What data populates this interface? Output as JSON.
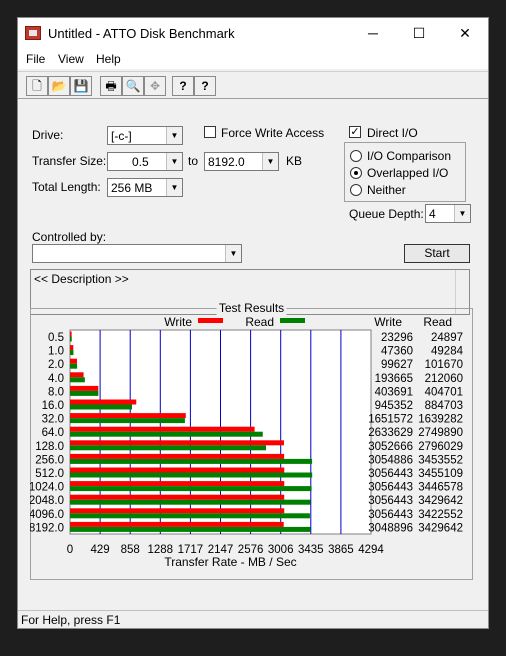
{
  "window": {
    "title": "Untitled - ATTO Disk Benchmark",
    "minimize": "─",
    "maximize": "☐",
    "close": "✕"
  },
  "menu": {
    "file": "File",
    "view": "View",
    "help": "Help"
  },
  "toolbar": {
    "new": "🗋",
    "open": "📂",
    "save": "💾",
    "print": "🖶",
    "preview": "🔍",
    "move": "✥",
    "help": "?",
    "context_help": "?"
  },
  "settings": {
    "drive_label": "Drive:",
    "drive_value": "[-c-]",
    "force_write_access_label": "Force Write Access",
    "force_write_access_checked": false,
    "direct_io_label": "Direct I/O",
    "direct_io_checked": true,
    "transfer_size_label": "Transfer Size:",
    "transfer_from": "0.5",
    "to_label": "to",
    "transfer_to": "8192.0",
    "kb_label": "KB",
    "total_length_label": "Total Length:",
    "total_length_value": "256 MB",
    "io_comparison_label": "I/O Comparison",
    "overlapped_io_label": "Overlapped I/O",
    "neither_label": "Neither",
    "selected_mode": "Overlapped I/O",
    "queue_depth_label": "Queue Depth:",
    "queue_depth_value": "4",
    "controlled_by_label": "Controlled by:",
    "controlled_by_value": "",
    "start_label": "Start",
    "description": "<< Description >>"
  },
  "chart_data": {
    "type": "bar",
    "title": "Test Results",
    "xlabel": "Transfer Rate - MB / Sec",
    "xlim": [
      0,
      4294
    ],
    "xticks": [
      "0",
      "429",
      "858",
      "1288",
      "1717",
      "2147",
      "2576",
      "3006",
      "3435",
      "3865",
      "4294"
    ],
    "categories": [
      "0.5",
      "1.0",
      "2.0",
      "4.0",
      "8.0",
      "16.0",
      "32.0",
      "64.0",
      "128.0",
      "256.0",
      "512.0",
      "1024.0",
      "2048.0",
      "4096.0",
      "8192.0"
    ],
    "series": [
      {
        "name": "Write",
        "color": "#ff0000",
        "values": [
          23296,
          47360,
          99627,
          193665,
          403691,
          945352,
          1651572,
          2633629,
          3052666,
          3054886,
          3056443,
          3056443,
          3056443,
          3056443,
          3048896
        ]
      },
      {
        "name": "Read",
        "color": "#008000",
        "values": [
          24897,
          49284,
          101670,
          212060,
          404701,
          884703,
          1639282,
          2749890,
          2796029,
          3453552,
          3455109,
          3446578,
          3429642,
          3422552,
          3429642
        ]
      }
    ],
    "column_headers": {
      "write": "Write",
      "read": "Read"
    },
    "legend_position": "top"
  },
  "status": {
    "text": "For Help, press F1"
  },
  "colors": {
    "write": "#ff0000",
    "read": "#008000",
    "grid": "#0000c8"
  }
}
